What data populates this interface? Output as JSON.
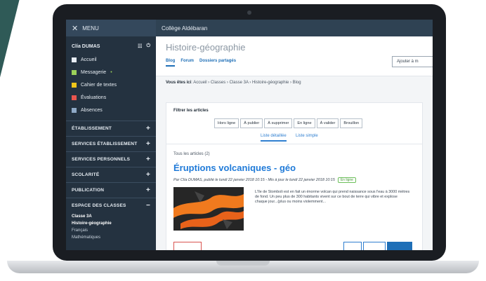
{
  "sidebar": {
    "menu_label": "MENU",
    "user_name": "Clía DUMAS",
    "items": [
      {
        "label": "Accueil",
        "icon": "grid-icon",
        "color": "#e8eef5"
      },
      {
        "label": "Messagerie",
        "icon": "mail-icon",
        "color": "#9bd15a"
      },
      {
        "label": "Cahier de textes",
        "icon": "notebook-icon",
        "color": "#f0c61a"
      },
      {
        "label": "Évaluations",
        "icon": "clipboard-icon",
        "color": "#e8554e"
      },
      {
        "label": "Absences",
        "icon": "person-icon",
        "color": "#8fa9c6"
      }
    ],
    "sections": [
      {
        "label": "ÉTABLISSEMENT"
      },
      {
        "label": "SERVICES ÉTABLISSEMENT"
      },
      {
        "label": "SERVICES PERSONNELS"
      },
      {
        "label": "SCOLARITÉ"
      },
      {
        "label": "PUBLICATION"
      }
    ],
    "open_section": {
      "label": "ESPACE DES CLASSES"
    },
    "class_name": "Classe 3A",
    "class_items": [
      "Histoire-géographie",
      "Français",
      "Mathématiques"
    ]
  },
  "topbar": {
    "school": "Collège Aldébaran"
  },
  "header": {
    "title": "Histoire-géographie",
    "tabs": [
      "Blog",
      "Forum",
      "Dossiers partagés"
    ],
    "add_button": "Ajouter à m"
  },
  "breadcrumb": {
    "label": "Vous êtes ici",
    "path": ": Accueil › Classes › Classe 3A › Histoire-géographie › Blog"
  },
  "filters": {
    "title": "Filtrer les articles",
    "buttons": [
      "Hors ligne",
      "À publier",
      "À supprimer",
      "En ligne",
      "À valider",
      "Brouillon"
    ]
  },
  "list_tabs": [
    "Liste détaillée",
    "Liste simple"
  ],
  "article_count": "Tous les articles (2)",
  "article": {
    "title": "Éruptions volcaniques - géo",
    "byline": "Par Clía DUMAS, publié le lundi 22 janvier 2018 10:15 - Mis à jour le lundi 22 janvier 2018 10:15",
    "status": "En ligne",
    "excerpt": "L'île de Stomboli est en fait un énorme volcan qui prend naissance sous l'eau à 3000 mètres de fond. Un peu plus de 300 habitants vivent sur ce bout de terre qui vibre et explose chaque jour...(plus ou moins violemment..."
  },
  "colors": {
    "sidebar_bg": "#243240",
    "accent": "#1f6fb7",
    "lava": "#f07a1e"
  }
}
